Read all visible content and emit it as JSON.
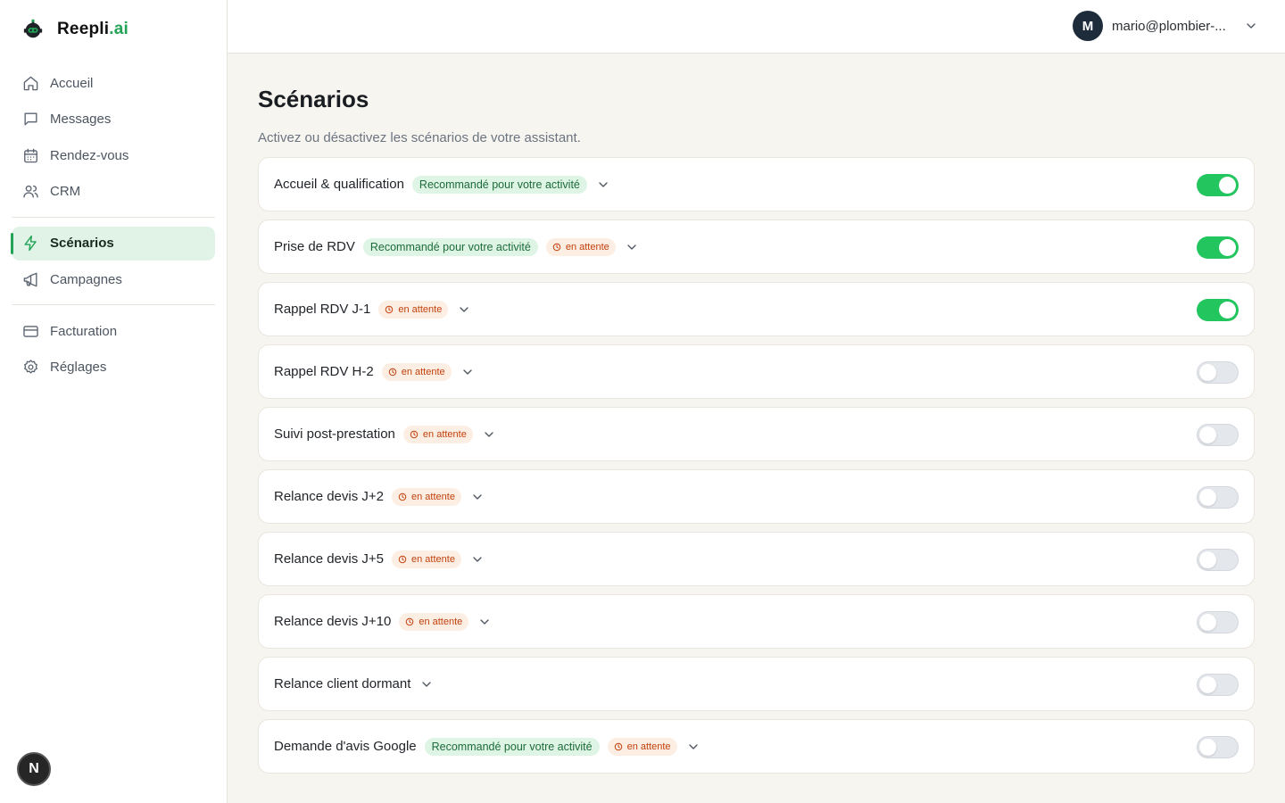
{
  "brand": {
    "name": "Reepli",
    "suffix": ".ai"
  },
  "nav": [
    {
      "label": "Accueil",
      "icon": "home-icon"
    },
    {
      "label": "Messages",
      "icon": "message-icon"
    },
    {
      "label": "Rendez-vous",
      "icon": "calendar-icon"
    },
    {
      "label": "CRM",
      "icon": "users-icon"
    },
    {
      "label": "Scénarios",
      "icon": "zap-icon",
      "active": true
    },
    {
      "label": "Campagnes",
      "icon": "megaphone-icon"
    },
    {
      "label": "Facturation",
      "icon": "credit-card-icon"
    },
    {
      "label": "Réglages",
      "icon": "settings-icon"
    }
  ],
  "bottom_badge": "N",
  "user": {
    "initial": "M",
    "email": "mario@plombier-..."
  },
  "page": {
    "title": "Scénarios",
    "subtitle": "Activez ou désactivez les scénarios de votre assistant."
  },
  "tags": {
    "recommended": "Recommandé pour votre activité",
    "pending": "en attente"
  },
  "colors": {
    "accent": "#22a357",
    "toggle_on": "#22c55e",
    "pending_text": "#c2410c"
  },
  "scenarios": [
    {
      "title": "Accueil & qualification",
      "recommended": true,
      "pending": false,
      "enabled": true
    },
    {
      "title": "Prise de RDV",
      "recommended": true,
      "pending": true,
      "enabled": true
    },
    {
      "title": "Rappel RDV J-1",
      "recommended": false,
      "pending": true,
      "enabled": true
    },
    {
      "title": "Rappel RDV H-2",
      "recommended": false,
      "pending": true,
      "enabled": false
    },
    {
      "title": "Suivi post-prestation",
      "recommended": false,
      "pending": true,
      "enabled": false
    },
    {
      "title": "Relance devis J+2",
      "recommended": false,
      "pending": true,
      "enabled": false
    },
    {
      "title": "Relance devis J+5",
      "recommended": false,
      "pending": true,
      "enabled": false
    },
    {
      "title": "Relance devis J+10",
      "recommended": false,
      "pending": true,
      "enabled": false
    },
    {
      "title": "Relance client dormant",
      "recommended": false,
      "pending": false,
      "enabled": false
    },
    {
      "title": "Demande d'avis Google",
      "recommended": true,
      "pending": true,
      "enabled": false
    }
  ]
}
